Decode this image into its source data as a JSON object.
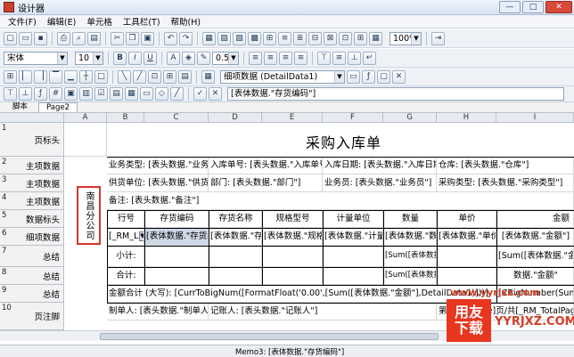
{
  "window": {
    "title": "设计器",
    "min": "—",
    "max": "□",
    "close": "✕"
  },
  "menubar": [
    {
      "label": "文件(F)"
    },
    {
      "label": "编辑(E)"
    },
    {
      "label": "单元格"
    },
    {
      "label": "工具栏(T)"
    },
    {
      "label": "帮助(H)"
    }
  ],
  "toolbar1": {
    "zoom": "100%"
  },
  "toolbar2": {
    "font": "宋体",
    "size": "10",
    "line_width": "0.5"
  },
  "toolbar3": {
    "dataset": "细项数据 (DetailData1)"
  },
  "formula": {
    "value": "[表体数据.\"存货编码\"]"
  },
  "tabs": [
    {
      "label": "脚本"
    },
    {
      "label": "Page2"
    }
  ],
  "columns": [
    "A",
    "B",
    "C",
    "D",
    "E",
    "F",
    "G",
    "H",
    "I"
  ],
  "rows": [
    {
      "num": "1",
      "label": "页标头"
    },
    {
      "num": "2",
      "label": "主项数据"
    },
    {
      "num": "3",
      "label": "主项数据"
    },
    {
      "num": "4",
      "label": "主项数据"
    },
    {
      "num": "5",
      "label": "数据标头"
    },
    {
      "num": "6",
      "label": "细项数据"
    },
    {
      "num": "7",
      "label": "总结"
    },
    {
      "num": "8",
      "label": "总结"
    },
    {
      "num": "9",
      "label": "总结"
    },
    {
      "num": "10",
      "label": "页注脚"
    }
  ],
  "report": {
    "title": "采购入库单",
    "stamp": "南昌分公司",
    "r2": [
      "业务类型: [表头数据.\"业务类型\"]",
      "入库单号: [表头数据.\"入库单号\"]",
      "入库日期: [表头数据.\"入库日期\"]",
      "仓库: [表头数据.\"仓库\"]"
    ],
    "r3": [
      "供货单位: [表头数据.\"供货单位\"]",
      "部门: [表头数据.\"部门\"]",
      "业务员: [表头数据.\"业务员\"]",
      "采购类型: [表头数据.\"采购类型\"]"
    ],
    "r4": "备注: [表头数据.\"备注\"]",
    "headers": [
      "行号",
      "存货编码",
      "存货名称",
      "规格型号",
      "计量单位",
      "数量",
      "单价",
      "金额"
    ],
    "r6": [
      "[_RM_L",
      "[表体数据.\"存货编码\"]",
      "[表体数据.\"存货名称\"]",
      "[表体数据.\"规格型号\"]",
      "[表体数据.\"计量单位\"]",
      "[表体数据.\"数量\"]",
      "[表体数据.\"单价\"]",
      "[表体数据.\"金额\"]"
    ],
    "r7_label": "小计:",
    "r7_g": "[Sum([表体数据.\"数量\"]",
    "r7_i": "[Sum([表体数据.\"金额\"]",
    "r8_label": "合计:",
    "r8_g": "[Sum([表体数据.\"数量\"]",
    "r8_i": "数据.\"金额\"",
    "r9": "金额合计 (大写): [CurrToBigNum([FormatFloat('0.00',[Sum([表体数据.\"金额\"],DetailData1)]))]",
    "r9_right": "[CBigNumber(Sum",
    "r10_left": "制单人: [表头数据.\"制单人\"]",
    "r10_mid": "记账人: [表头数据.\"记账人\"]",
    "r10_right": "第[_RM_Page]页/共[_RM_TotalPages]页"
  },
  "status": {
    "text": "Memo3: [表体数据.\"存货编码\"]"
  },
  "watermark": {
    "badge1": "用友",
    "badge2": "下载",
    "url": "YYRJXZ.COM",
    "site": "www.yyrjxz.com"
  },
  "colors": {
    "stamp_border": "#d6342c",
    "watermark": "#e8361f"
  }
}
